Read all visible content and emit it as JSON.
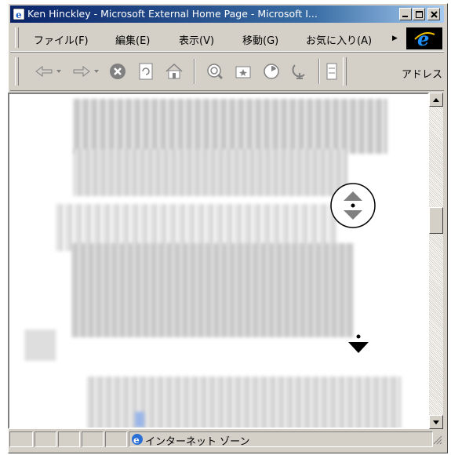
{
  "window": {
    "title": "Ken Hinckley - Microsoft External Home Page - Microsoft I..."
  },
  "menu": {
    "items": [
      "ファイル(F)",
      "編集(E)",
      "表示(V)",
      "移動(G)",
      "お気に入り(A)"
    ]
  },
  "toolbar": {
    "address_label": "アドレス",
    "icons": [
      "back-icon",
      "forward-icon",
      "stop-icon",
      "refresh-icon",
      "home-icon",
      "search-icon",
      "favorites-icon",
      "history-icon",
      "channels-icon",
      "fullscreen-icon"
    ]
  },
  "status": {
    "zone_text": "インターネット ゾーン"
  },
  "colors": {
    "titlebar_start": "#0a246a",
    "titlebar_end": "#a6caf0",
    "chrome": "#d4d0c8"
  }
}
